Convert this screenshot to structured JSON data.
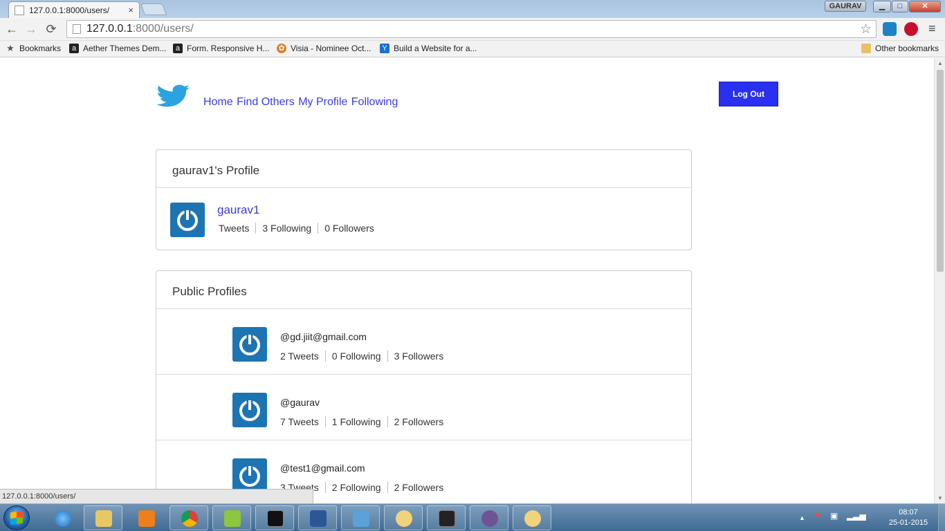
{
  "browser": {
    "tab_title": "127.0.0.1:8000/users/",
    "tab_close": "×",
    "profile_name": "GAURAV",
    "window_buttons": {
      "minimize": "▁",
      "maximize": "□",
      "close": "✕"
    },
    "nav": {
      "back": "←",
      "forward": "→",
      "reload": "⟳"
    },
    "url_host": "127.0.0.1",
    "url_rest": ":8000/users/",
    "star": "☆",
    "menu": "≡",
    "bookmarks": [
      {
        "label": "Bookmarks",
        "icon": "star-icon",
        "glyph": "★"
      },
      {
        "label": "Aether Themes Dem...",
        "icon": "a-icon",
        "glyph": "a"
      },
      {
        "label": "Form. Responsive H...",
        "icon": "a-icon",
        "glyph": "a"
      },
      {
        "label": "Visia - Nominee Oct...",
        "icon": "flower-icon",
        "glyph": "✿"
      },
      {
        "label": "Build a Website for a...",
        "icon": "y-icon",
        "glyph": "Y"
      }
    ],
    "other_bookmarks": "Other bookmarks",
    "status_bubble": "127.0.0.1:8000/users/"
  },
  "site": {
    "nav_links": [
      "Home",
      "Find Others",
      "My Profile",
      "Following"
    ],
    "logout_label": "Log Out"
  },
  "profile_panel": {
    "title": "gaurav1's Profile",
    "username": "gaurav1",
    "stats": [
      "Tweets",
      "3 Following",
      "0 Followers"
    ]
  },
  "public_panel": {
    "title": "Public Profiles",
    "profiles": [
      {
        "handle": "@gd.jiit@gmail.com",
        "stats": [
          "2 Tweets",
          "0 Following",
          "3 Followers"
        ]
      },
      {
        "handle": "@gaurav",
        "stats": [
          "7 Tweets",
          "1 Following",
          "2 Followers"
        ]
      },
      {
        "handle": "@test1@gmail.com",
        "stats": [
          "3 Tweets",
          "2 Following",
          "2 Followers"
        ]
      }
    ]
  },
  "taskbar": {
    "clock_time": "08:07",
    "clock_date": "25-01-2015",
    "tray_up": "▲"
  },
  "colors": {
    "link": "#3b3bdc",
    "logout_bg": "#2930f0",
    "avatar_bg": "#1d74b3",
    "twitter_blue": "#2ba3e3"
  }
}
